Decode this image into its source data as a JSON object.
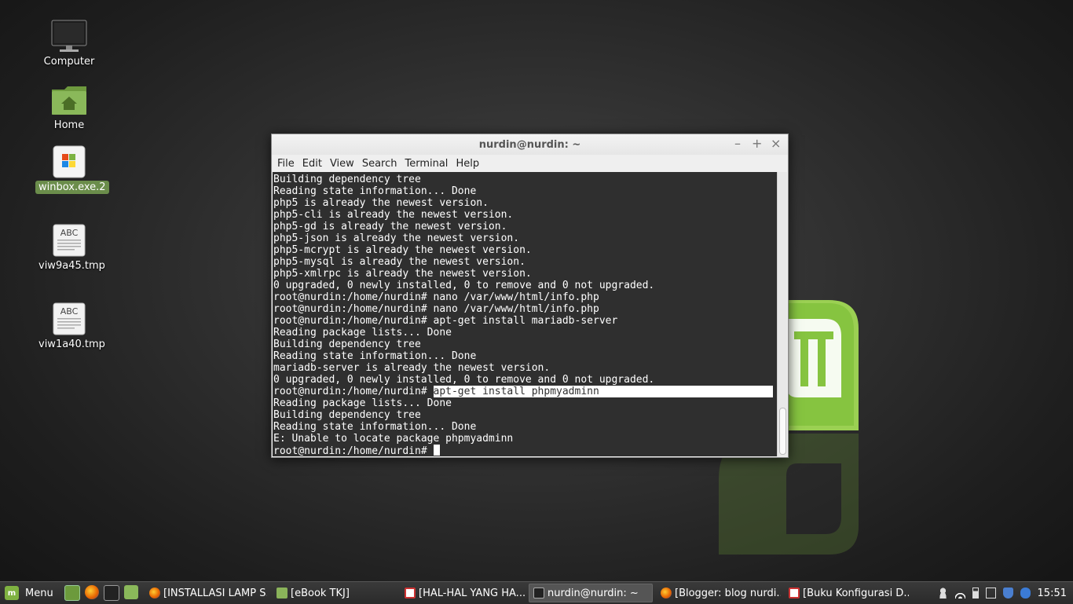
{
  "desktop": {
    "icons": [
      {
        "label": "Computer",
        "selected": false
      },
      {
        "label": "Home",
        "selected": false
      },
      {
        "label": "winbox.exe.2",
        "selected": true
      },
      {
        "label": "viw9a45.tmp",
        "selected": false
      },
      {
        "label": "viw1a40.tmp",
        "selected": false
      }
    ],
    "text_file_glyph": "ABC"
  },
  "window": {
    "title": "nurdin@nurdin: ~",
    "controls": {
      "minimize": "–",
      "maximize": "+",
      "close": "×"
    },
    "menu": [
      "File",
      "Edit",
      "View",
      "Search",
      "Terminal",
      "Help"
    ]
  },
  "terminal": {
    "lines": [
      "Building dependency tree",
      "Reading state information... Done",
      "php5 is already the newest version.",
      "php5-cli is already the newest version.",
      "php5-gd is already the newest version.",
      "php5-json is already the newest version.",
      "php5-mcrypt is already the newest version.",
      "php5-mysql is already the newest version.",
      "php5-xmlrpc is already the newest version.",
      "0 upgraded, 0 newly installed, 0 to remove and 0 not upgraded.",
      "root@nurdin:/home/nurdin# nano /var/www/html/info.php",
      "root@nurdin:/home/nurdin# nano /var/www/html/info.php",
      "root@nurdin:/home/nurdin# apt-get install mariadb-server",
      "Reading package lists... Done",
      "Building dependency tree",
      "Reading state information... Done",
      "mariadb-server is already the newest version.",
      "0 upgraded, 0 newly installed, 0 to remove and 0 not upgraded."
    ],
    "selected_prompt": "root@nurdin:/home/nurdin# ",
    "selected_text": "apt-get install phpmyadminn",
    "after_lines": [
      "Reading package lists... Done",
      "Building dependency tree",
      "Reading state information... Done",
      "E: Unable to locate package phpmyadminn"
    ],
    "prompt": "root@nurdin:/home/nurdin# "
  },
  "taskbar": {
    "menu_label": "Menu",
    "launchers": [
      "show-desktop-icon",
      "firefox-icon",
      "terminal-icon",
      "files-icon"
    ],
    "tasks": [
      {
        "label": "[INSTALLASI LAMP S...",
        "icon": "firefox-icon",
        "color": "#e66000",
        "active": false
      },
      {
        "label": "[eBook TKJ]",
        "icon": "folder-icon",
        "color": "#8ab35a",
        "active": false
      },
      {
        "label": "[HAL-HAL YANG HA...",
        "icon": "pdf-icon",
        "color": "#c33",
        "active": false
      },
      {
        "label": "nurdin@nurdin: ~",
        "icon": "terminal-icon",
        "color": "#333",
        "active": true
      },
      {
        "label": "[Blogger: blog nurdi...",
        "icon": "firefox-icon",
        "color": "#e66000",
        "active": false
      },
      {
        "label": "[Buku Konfigurasi D...",
        "icon": "pdf-icon",
        "color": "#c33",
        "active": false
      }
    ],
    "tray": [
      "user-icon",
      "wifi-icon",
      "battery-icon",
      "clipboard-icon",
      "shield-icon",
      "bluetooth-icon"
    ],
    "clock": "15:51"
  },
  "colors": {
    "accent": "#7fb241",
    "selection": "#6b8d4b",
    "terminal_bg": "#2f2f2f"
  }
}
